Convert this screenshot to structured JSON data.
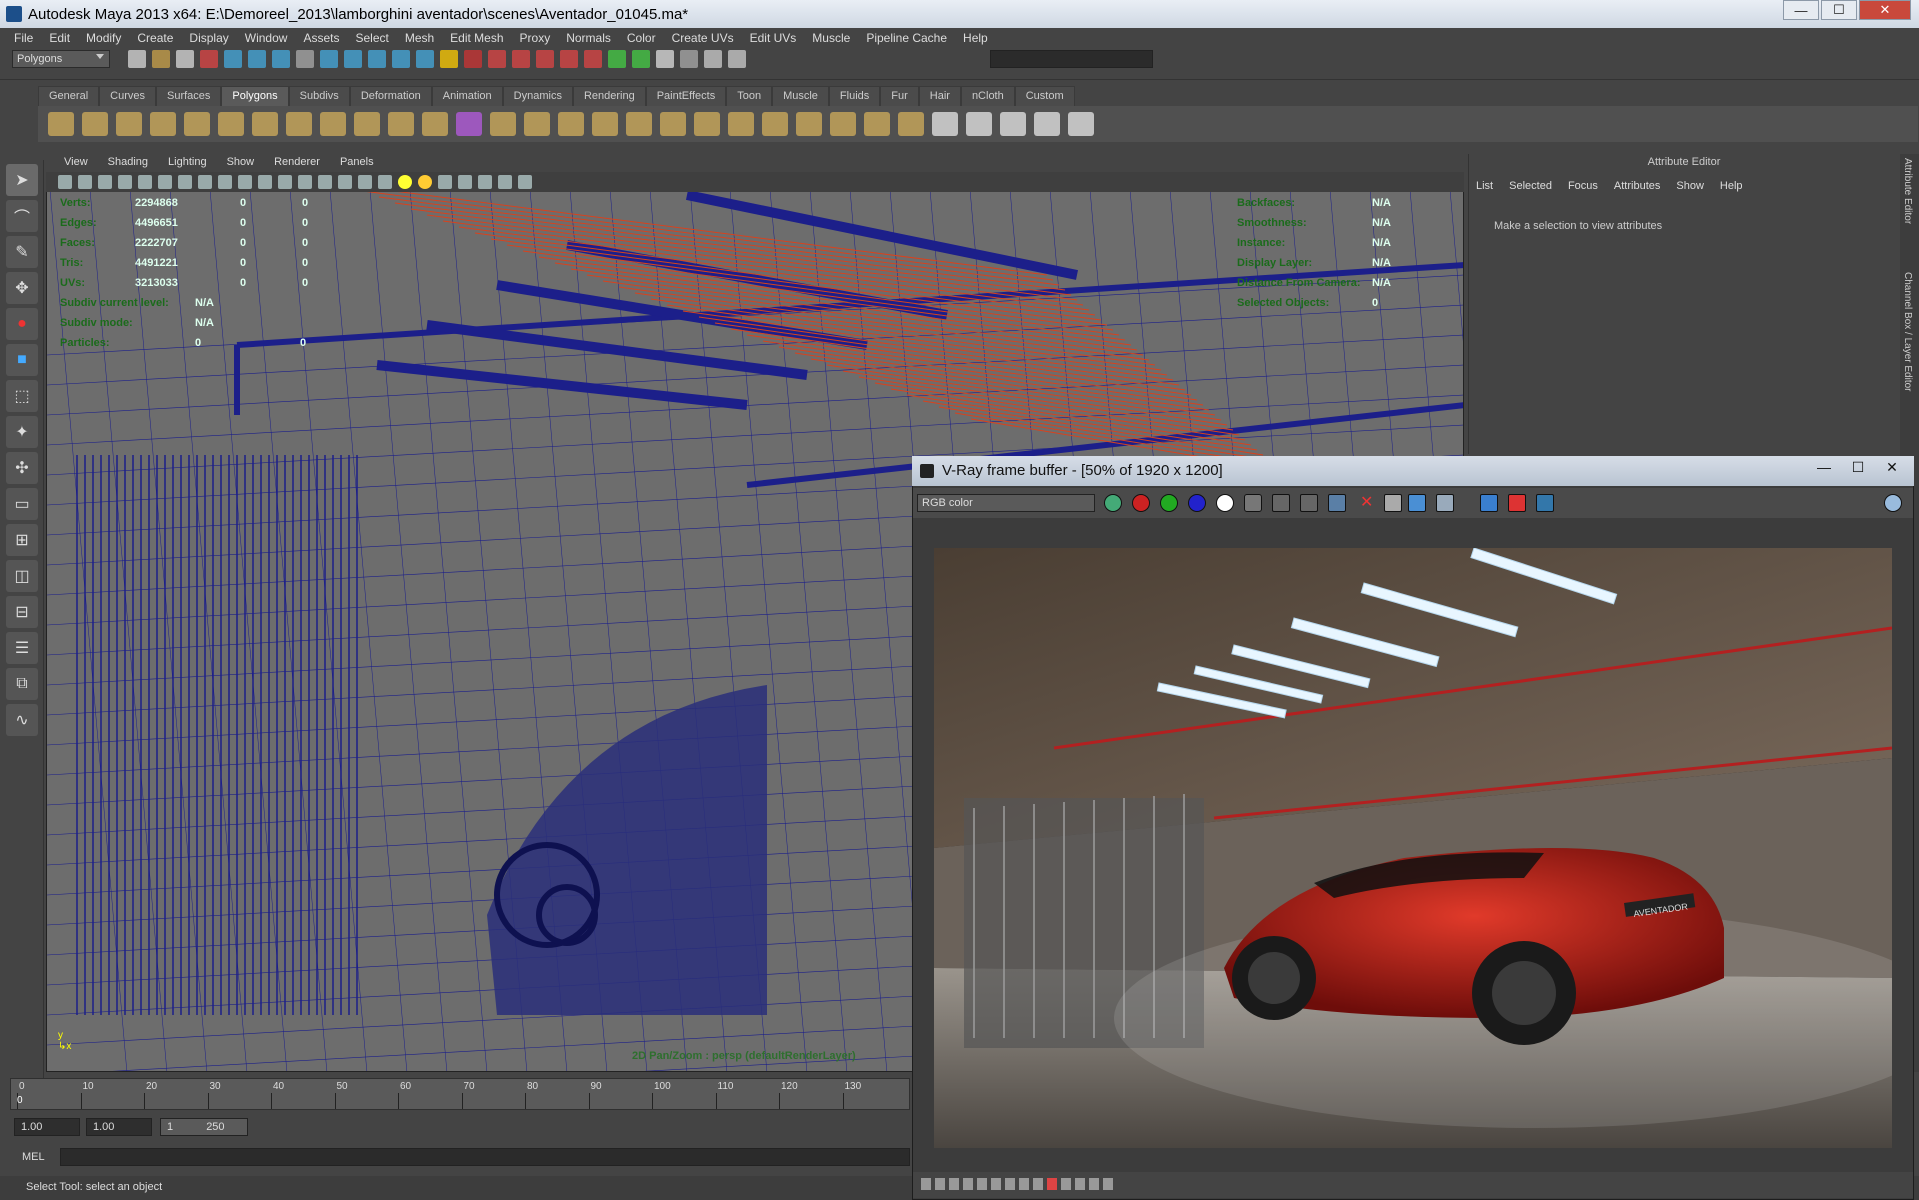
{
  "window": {
    "title": "Autodesk Maya 2013 x64: E:\\Demoreel_2013\\lamborghini aventador\\scenes\\Aventador_01045.ma*",
    "min": "—",
    "max": "☐",
    "close": "✕"
  },
  "menus": [
    "File",
    "Edit",
    "Modify",
    "Create",
    "Display",
    "Window",
    "Assets",
    "Select",
    "Mesh",
    "Edit Mesh",
    "Proxy",
    "Normals",
    "Color",
    "Create UVs",
    "Edit UVs",
    "Muscle",
    "Pipeline Cache",
    "Help"
  ],
  "mode": "Polygons",
  "shelf_tabs": [
    "General",
    "Curves",
    "Surfaces",
    "Polygons",
    "Subdivs",
    "Deformation",
    "Animation",
    "Dynamics",
    "Rendering",
    "PaintEffects",
    "Toon",
    "Muscle",
    "Fluids",
    "Fur",
    "Hair",
    "nCloth",
    "Custom"
  ],
  "active_shelf": "Polygons",
  "viewport": {
    "menu": [
      "View",
      "Shading",
      "Lighting",
      "Show",
      "Renderer",
      "Panels"
    ],
    "hud_left": [
      {
        "k": "Verts:",
        "v1": "2294868",
        "v2": "0",
        "v3": "0"
      },
      {
        "k": "Edges:",
        "v1": "4496651",
        "v2": "0",
        "v3": "0"
      },
      {
        "k": "Faces:",
        "v1": "2222707",
        "v2": "0",
        "v3": "0"
      },
      {
        "k": "Tris:",
        "v1": "4491221",
        "v2": "0",
        "v3": "0"
      },
      {
        "k": "UVs:",
        "v1": "3213033",
        "v2": "0",
        "v3": "0"
      },
      {
        "k": "Subdiv current level:",
        "v1": "N/A",
        "v2": "",
        "v3": ""
      },
      {
        "k": "Subdiv mode:",
        "v1": "N/A",
        "v2": "",
        "v3": ""
      },
      {
        "k": "Particles:",
        "v1": "0",
        "v2": "0",
        "v3": ""
      }
    ],
    "hud_right": [
      {
        "k": "Backfaces:",
        "v": "N/A"
      },
      {
        "k": "Smoothness:",
        "v": "N/A"
      },
      {
        "k": "Instance:",
        "v": "N/A"
      },
      {
        "k": "Display Layer:",
        "v": "N/A"
      },
      {
        "k": "Distance From Camera:",
        "v": "N/A"
      },
      {
        "k": "Selected Objects:",
        "v": "0"
      }
    ],
    "camera_label": "2D Pan/Zoom : persp (defaultRenderLayer)"
  },
  "attribute_editor": {
    "title": "Attribute Editor",
    "menu": [
      "List",
      "Selected",
      "Focus",
      "Attributes",
      "Show",
      "Help"
    ],
    "message": "Make a selection to view attributes",
    "side_tabs": [
      "Attribute Editor",
      "Channel Box / Layer Editor"
    ]
  },
  "timeline": {
    "ticks": [
      "0",
      "10",
      "20",
      "30",
      "40",
      "50",
      "60",
      "70",
      "80",
      "90",
      "100",
      "110",
      "120",
      "130"
    ],
    "current": "0",
    "range_start": "1.00",
    "range_current": "1.00",
    "range_min": "1",
    "range_max": "250"
  },
  "mel": {
    "label": "MEL"
  },
  "helpline": "Select Tool: select an object",
  "vfb": {
    "title": "V-Ray frame buffer - [50% of 1920 x 1200]",
    "channel": "RGB color",
    "plate": "AVENTADOR"
  },
  "colors": {
    "wire": "#1c1f8a",
    "lights": "#d9421d",
    "car": "#b81414"
  }
}
